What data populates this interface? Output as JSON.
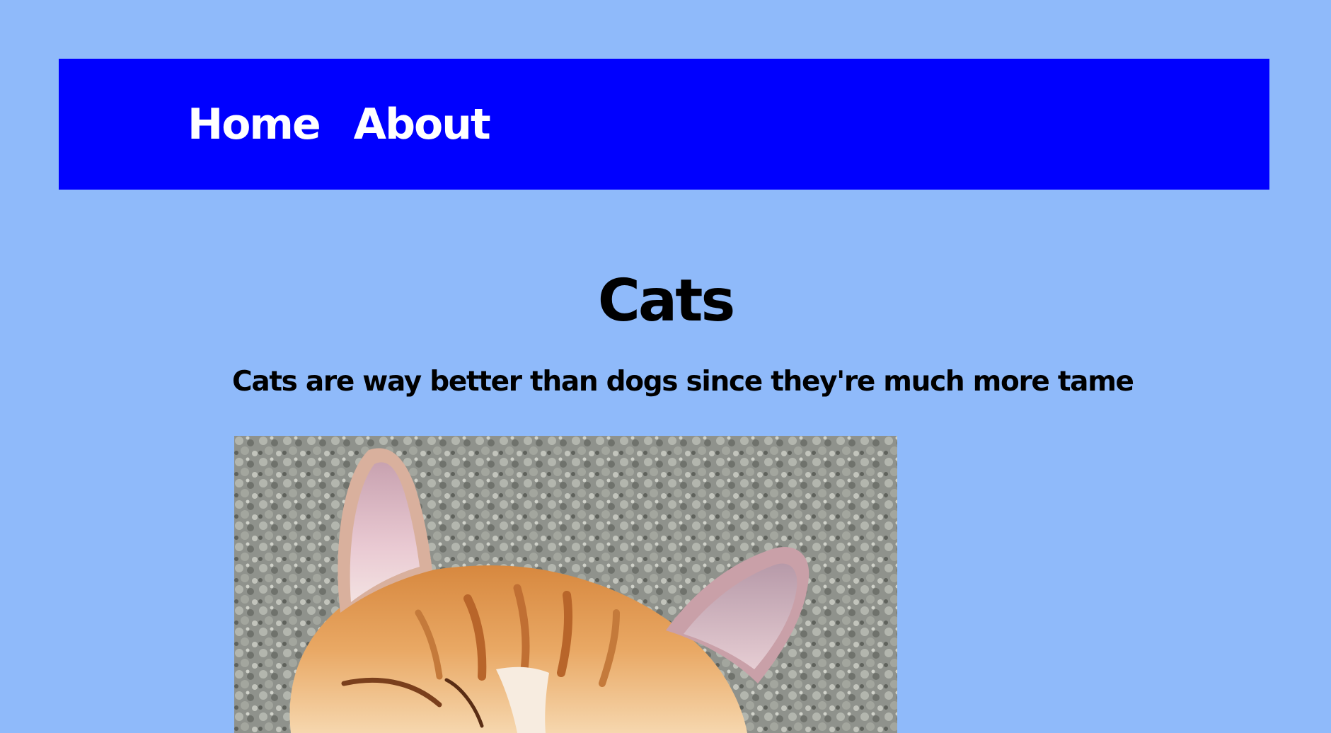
{
  "nav": {
    "links": [
      {
        "label": "Home"
      },
      {
        "label": "About"
      }
    ]
  },
  "main": {
    "title": "Cats",
    "description": "Cats are way better than dogs since they're much more tame",
    "image": {
      "icon": "cat-photo",
      "depicts": "orange tabby kitten ears on grey carpet"
    }
  },
  "colors": {
    "page_background": "#8fbafa",
    "navbar_background": "#0000ff",
    "nav_text": "#ffffff",
    "body_text": "#000000"
  }
}
